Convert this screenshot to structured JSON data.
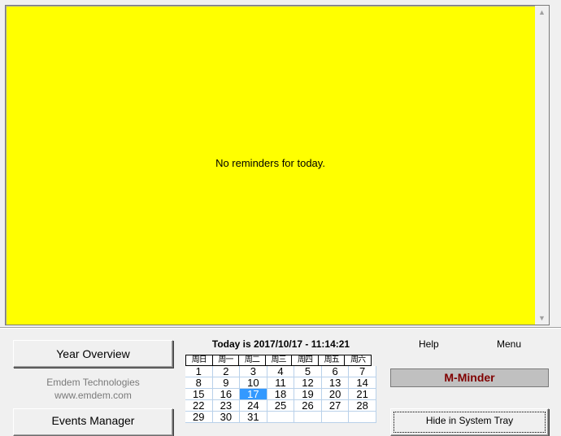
{
  "reminders": {
    "message": "No reminders for today."
  },
  "left": {
    "year_overview": "Year Overview",
    "company_name": "Emdem Technologies",
    "company_url": "www.emdem.com",
    "events_manager": "Events Manager"
  },
  "calendar": {
    "today_label": "Today is 2017/10/17 - 11:14:21",
    "weekdays": [
      "周日",
      "周一",
      "周二",
      "周三",
      "周四",
      "周五",
      "周六"
    ],
    "weeks": [
      [
        "1",
        "2",
        "3",
        "4",
        "5",
        "6",
        "7"
      ],
      [
        "8",
        "9",
        "10",
        "11",
        "12",
        "13",
        "14"
      ],
      [
        "15",
        "16",
        "17",
        "18",
        "19",
        "20",
        "21"
      ],
      [
        "22",
        "23",
        "24",
        "25",
        "26",
        "27",
        "28"
      ],
      [
        "29",
        "30",
        "31",
        "",
        "",
        "",
        ""
      ]
    ],
    "selected_day": "17"
  },
  "right": {
    "help": "Help",
    "menu": "Menu",
    "app_name": "M-Minder",
    "hide_button": "Hide in System Tray"
  },
  "colors": {
    "reminder_bg": "#ffff00",
    "app_name_text": "#800000",
    "selected_day_bg": "#3399ff"
  }
}
